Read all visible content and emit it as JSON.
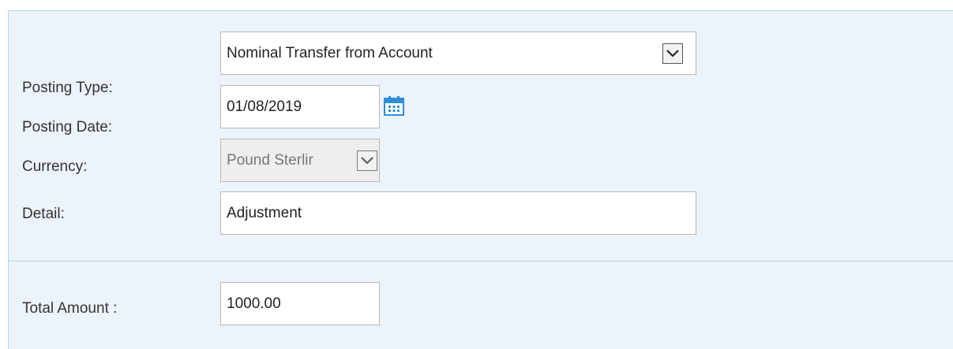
{
  "form": {
    "posting_type": {
      "label": "Posting Type:",
      "selected": "Nominal Transfer from Account",
      "icon": "chevron-down-icon"
    },
    "posting_date": {
      "label": "Posting Date:",
      "value": "01/08/2019",
      "icon": "calendar-icon"
    },
    "currency": {
      "label": "Currency:",
      "selected": "Pound Sterlir",
      "disabled": true,
      "icon": "chevron-down-icon"
    },
    "detail": {
      "label": "Detail:",
      "value": "Adjustment"
    },
    "total_amount": {
      "label": "Total Amount :",
      "value": "1000.00"
    }
  },
  "colors": {
    "panel_background": "#ecf3fb",
    "panel_border": "#b3d3ea",
    "calendar_icon": "#2e8fd8"
  }
}
